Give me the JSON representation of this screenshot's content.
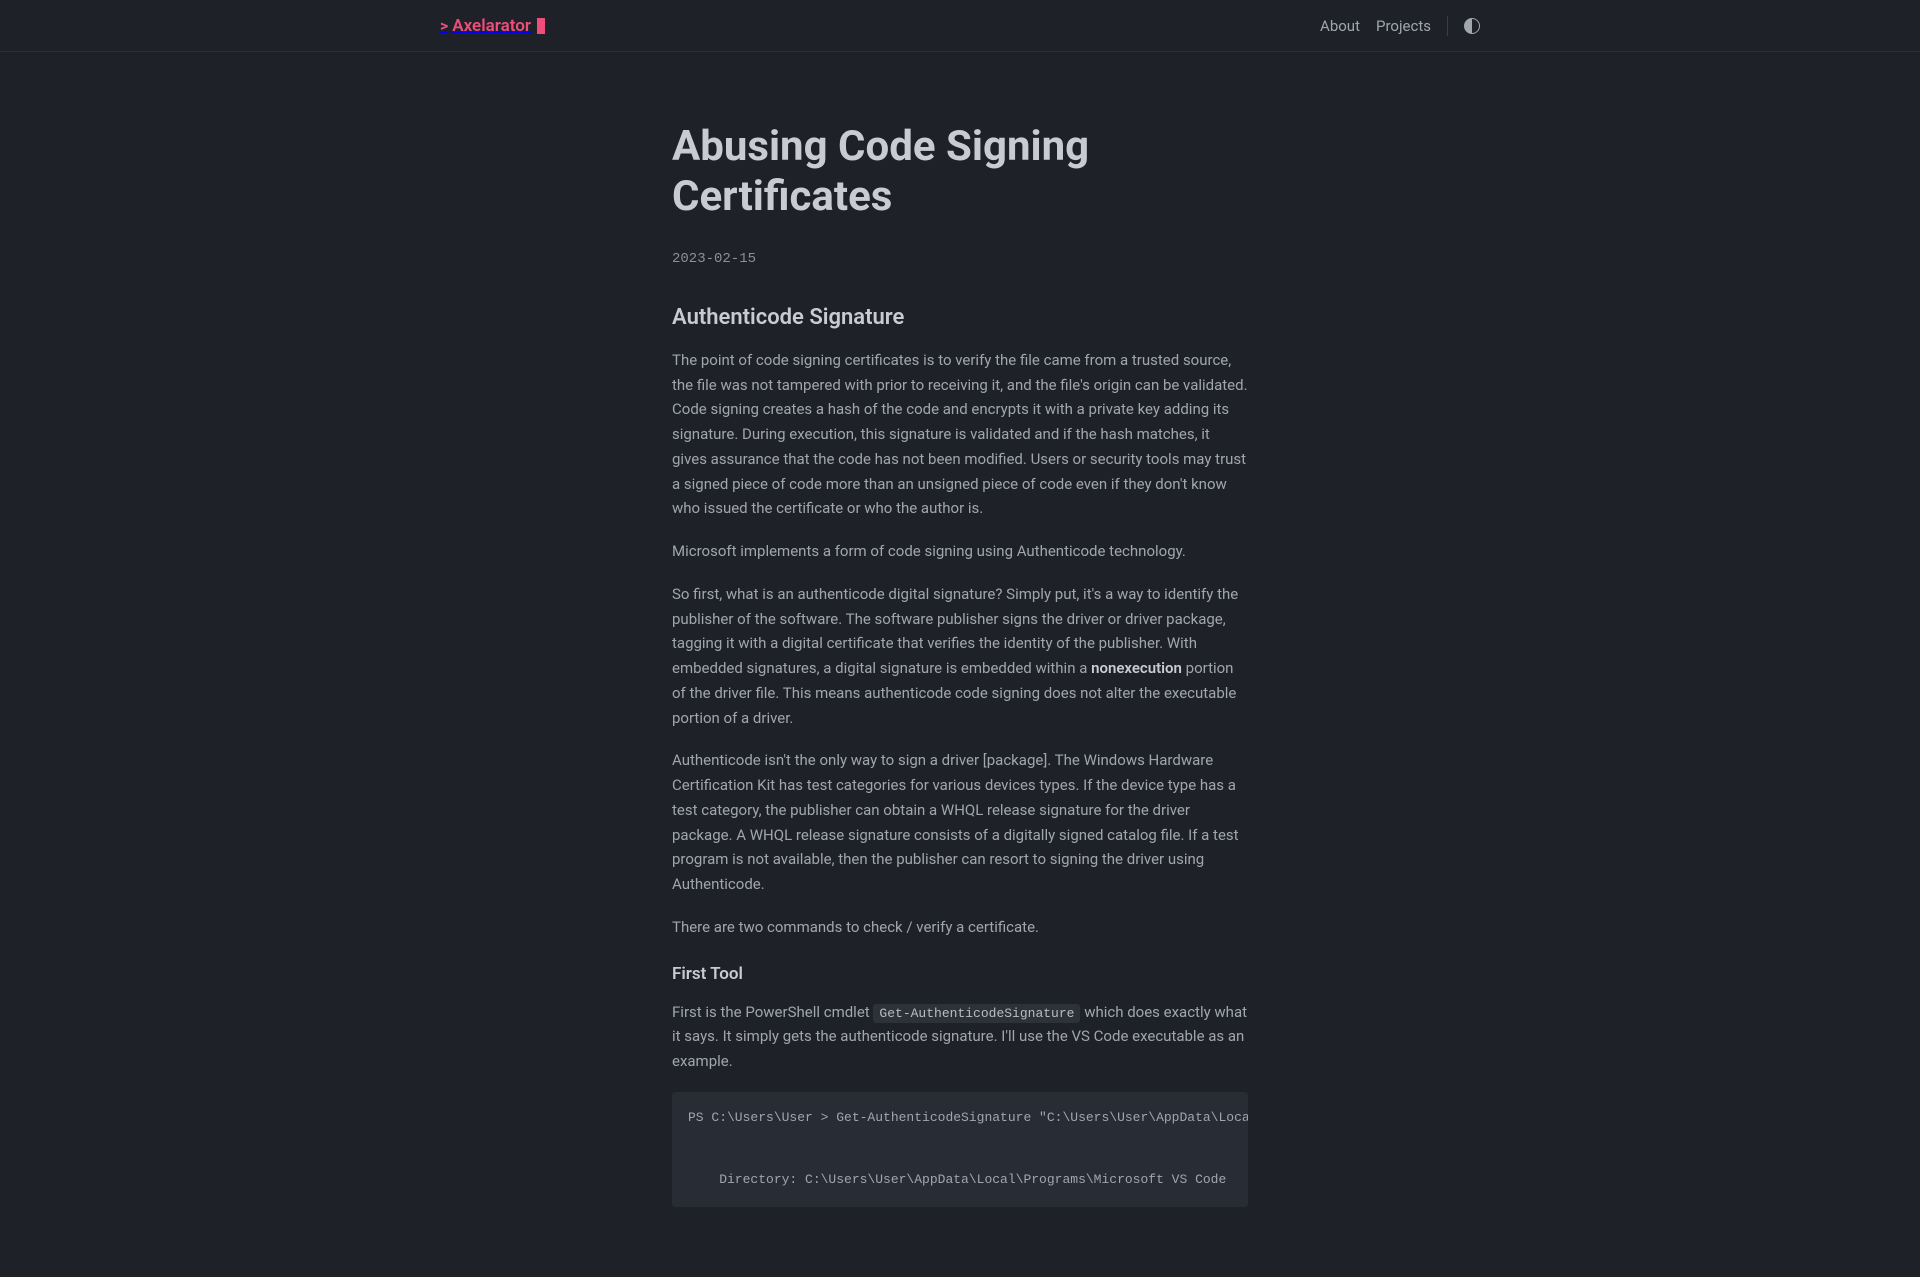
{
  "header": {
    "logo_text": "Axelarator",
    "nav": {
      "about": "About",
      "projects": "Projects"
    }
  },
  "article": {
    "title": "Abusing Code Signing Certificates",
    "date": "2023-02-15",
    "section1_heading": "Authenticode Signature",
    "para1": "The point of code signing certificates is to verify the file came from a trusted source, the file was not tampered with prior to receiving it, and the file's origin can be validated. Code signing creates a hash of the code and encrypts it with a private key adding its signature. During execution, this signature is validated and if the hash matches, it gives assurance that the code has not been modified. Users or security tools may trust a signed piece of code more than an unsigned piece of code even if they don't know who issued the certificate or who the author is.",
    "para2": "Microsoft implements a form of code signing using Authenticode technology.",
    "para3_pre": "So first, what is an authenticode digital signature? Simply put, it's a way to identify the publisher of the software. The software publisher signs the driver or driver package, tagging it with a digital certificate that verifies the identity of the publisher. With embedded signatures, a digital signature is embedded within a ",
    "para3_strong": "nonexecution",
    "para3_post": " portion of the driver file. This means authenticode code signing does not alter the executable portion of a driver.",
    "para4": "Authenticode isn't the only way to sign a driver [package]. The Windows Hardware Certification Kit has test categories for various devices types. If the device type has a test category, the publisher can obtain a WHQL release signature for the driver package. A WHQL release signature consists of a digitally signed catalog file. If a test program is not available, then the publisher can resort to signing the driver using Authenticode.",
    "para5": "There are two commands to check / verify a certificate.",
    "section2_heading": "First Tool",
    "para6_pre": "First is the PowerShell cmdlet ",
    "para6_code": "Get-AuthenticodeSignature",
    "para6_post": " which does exactly what it says. It simply gets the authenticode signature. I'll use the VS Code executable as an example.",
    "code_block": "PS C:\\Users\\User > Get-AuthenticodeSignature \"C:\\Users\\User\\AppData\\Local\\Programs\\Microsoft V\n\n\n    Directory: C:\\Users\\User\\AppData\\Local\\Programs\\Microsoft VS Code"
  }
}
